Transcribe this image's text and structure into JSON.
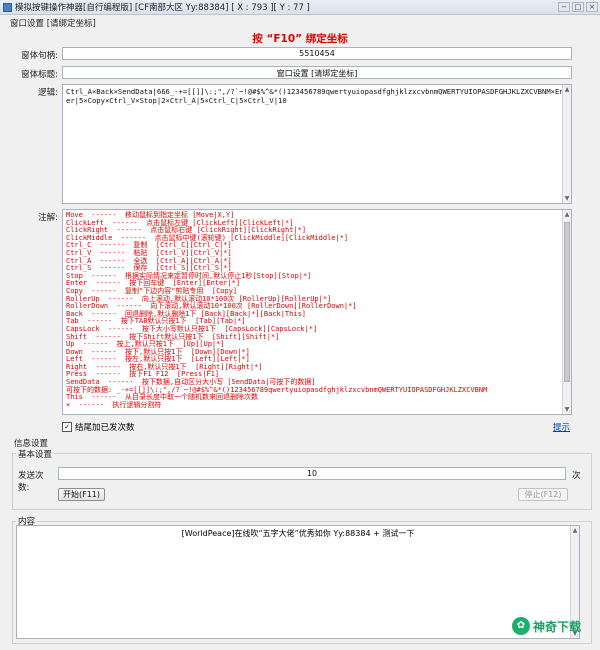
{
  "window": {
    "title": "模拟按键操作神器[自行编程版]  [CF南部大区 Yy:88384]  [ X : 793 ][ Y : 77 ]",
    "buttons": [
      "−",
      "□",
      "×"
    ]
  },
  "tab": {
    "label": "窗口设置  [请绑定坐标]"
  },
  "hotkey_hint": "按 “F10” 绑定坐标",
  "handle": {
    "label": "窗体句柄:",
    "value": "5510454"
  },
  "caption": {
    "label": "窗体标题:",
    "value": "窗口设置 [请绑定坐标]"
  },
  "logic": {
    "label": "逻辑:",
    "value": "Ctrl_A×Back×SendData|666_-+=[[]]\\:;\",/?`~!@#$%^&*()123456789qwertyuiopasdfghjklzxcvbnmQWERTYUIOPASDFGHJKLZXCVBNM×Enter|5×Copy×Ctrl_V×Stop|2×Ctrl_A|5×Ctrl_C|5×Ctrl_V|10"
  },
  "notes": {
    "label": "注解:",
    "lines": [
      "Move  ------  移动鼠标到指定坐标 [Move|X,Y]",
      "ClickLeft  ------  点击鼠标左键 [ClickLeft][ClickLeft|*]",
      "ClickRight  ------  点击鼠标右键 [ClickRight][ClickRight|*]",
      "ClickMiddle  ------  点击鼠标中键(滚轮键) [ClickMiddle][ClickMiddle|*]",
      "Ctrl_C  ------  复制  [Ctrl_C][Ctrl_C|*]",
      "Ctrl_V  ------  粘贴  [Ctrl_V][Ctrl_V|*]",
      "Ctrl_A  ------  全选  [Ctrl_A][Ctrl_A|*]",
      "Ctrl_S  ------  保存  [Ctrl_S][Ctrl_S|*]",
      "Stop  ------  根据实际情况来定暂停时间,默认停止1秒[Stop][Stop|*]",
      "Enter  ------  按下回车键  [Enter][Enter|*]",
      "Copy  ------  复制\"下边内容\"剪贴专用  [Copy]",
      "RollerUp  ------  向上滚动,默认滚动10*100次 [RollerUp][RollerUp|*]",
      "RollerDown  ------  向下滚动,默认滚动10*100次 [RollerDown][RollerDown|*]",
      "Back  ------  回退删除,默认删除1下 [Back][Back|*][Back|This]",
      "Tab  ------  按下TAB默认只按1下  [Tab][Tab|*]",
      "CapsLock  ------  按下大小写默认只按1下  [CapsLock][CapsLock|*]",
      "Shift  ------  按下Shift默认只按1下  [Shift][Shift|*]",
      "Up  ------  按上,默认只按1下  [Up][Up|*]",
      "Down  ------  按下,默认只按1下  [Down][Down|*]",
      "Left  ------  按左,默认只按1下  [Left][Left|*]",
      "Right  ------  按右,默认只按1下  [Right][Right|*]",
      "Press  ------  按下F1 F12  [Press|F1]",
      "SendData  ------  按下数据,自动区分大小写 [SendData|可按下的数据]",
      "可按下的数据: _-+=[[]]\\:;\",/?`~!@#$%^&*()123456789qwertyuiopasdfghjklzxcvbnmQWERTYUIOPASDFGHJKLZXCVBNM",
      "This  ------  从目录长度中取一个随机数来回退删除次数",
      "×  ------  执行逻辑分割符"
    ]
  },
  "append_checkbox": {
    "label": "结尾加已发次数",
    "checked": true
  },
  "help_link": "提示",
  "info": {
    "title": "信息设置",
    "basic_title": "基本设置",
    "count_label": "发送次数:",
    "count_value": "10",
    "count_unit": "次",
    "start_button": "开始(F11)",
    "stop_button": "停止(F12)"
  },
  "content": {
    "title": "内容",
    "value": "[WorldPeace]在线吹“五字大佬”优秀如你 Yy:88384 + 测试一下"
  },
  "logo": {
    "mark": "✿",
    "text": "神奇下载"
  },
  "colors": {
    "accent_red": "#e00000",
    "link_blue": "#0645ad",
    "logo_green": "#18a063"
  }
}
